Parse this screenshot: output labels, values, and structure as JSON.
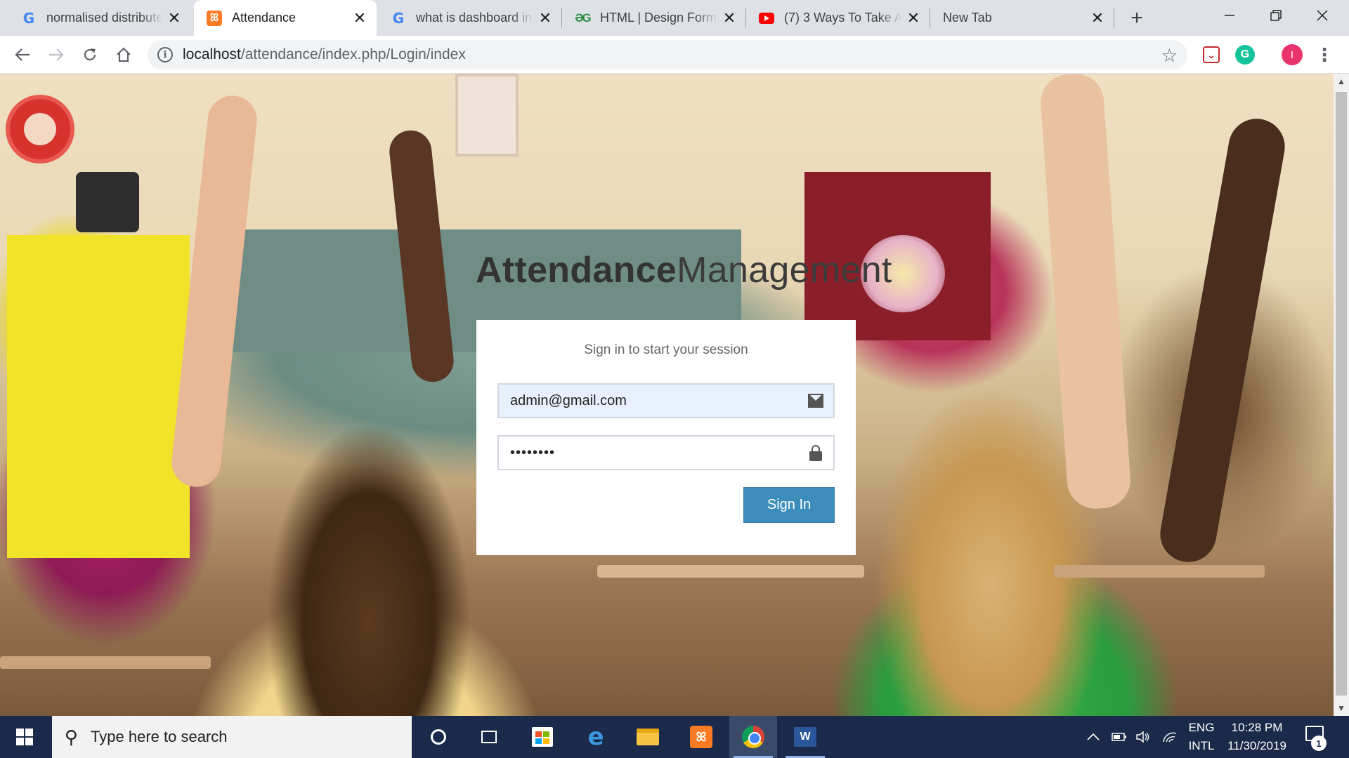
{
  "browser": {
    "tabs": [
      {
        "title": "normalised distributed",
        "favicon": "google-g-icon",
        "active": false
      },
      {
        "title": "Attendance",
        "favicon": "xampp-icon",
        "active": true
      },
      {
        "title": "what is dashboard in",
        "favicon": "google-g-icon",
        "active": false
      },
      {
        "title": "HTML | Design Form",
        "favicon": "geeksforgeeks-icon",
        "active": false
      },
      {
        "title": "(7) 3 Ways To Take A",
        "favicon": "youtube-icon",
        "active": false
      },
      {
        "title": "New Tab",
        "favicon": "",
        "active": false
      }
    ],
    "new_tab_label": "+",
    "url_host": "localhost",
    "url_path": "/attendance/index.php/Login/index",
    "profile_initial": "I"
  },
  "page": {
    "brand_bold": "Attendance",
    "brand_light": "Management",
    "login_message": "Sign in to start your session",
    "email_value": "admin@gmail.com",
    "password_value": "••••••••",
    "sign_in_label": "Sign In",
    "primary_color": "#3c8dbc"
  },
  "taskbar": {
    "search_placeholder": "Type here to search",
    "language_line1": "ENG",
    "language_line2": "INTL",
    "time": "10:28 PM",
    "date": "11/30/2019",
    "notification_count": "1"
  }
}
